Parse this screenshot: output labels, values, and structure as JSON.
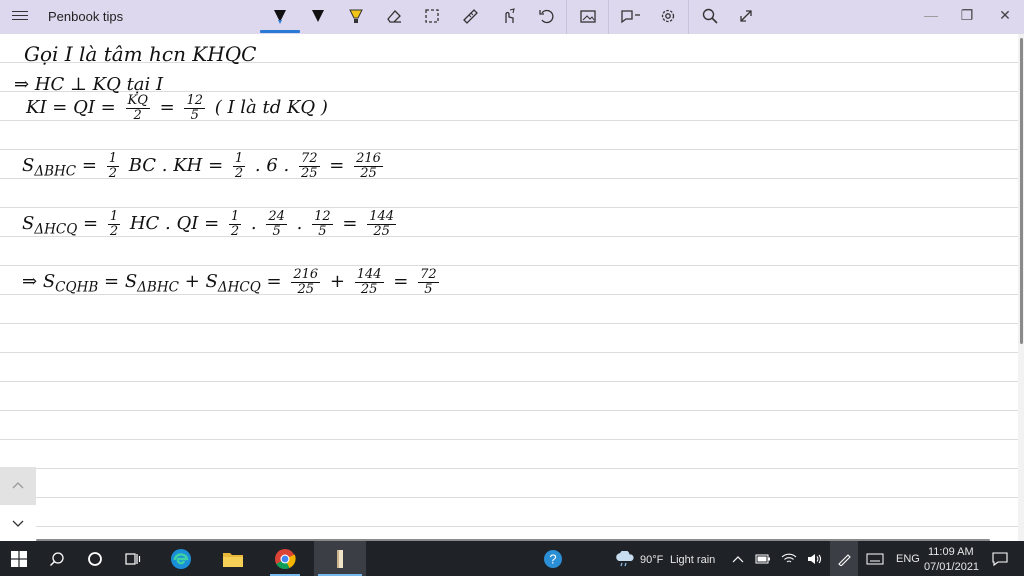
{
  "app": {
    "title": "Penbook tips",
    "window_controls": {
      "minimize": "—",
      "maximize": "❐",
      "close": "✕"
    }
  },
  "toolbar": {
    "tools": [
      "pen-black",
      "pen-black-2",
      "highlighter",
      "eraser",
      "lasso-select",
      "ruler",
      "touch-writing",
      "undo",
      "insert-image",
      "shapes",
      "settings",
      "search",
      "expand"
    ],
    "accent_color": "#2b79d6",
    "highlighter_color": "#f2c318"
  },
  "notes": {
    "line1": "Gọi I là tâm hcn KHQC",
    "line2": "⇒ HC ⊥ KQ tại I",
    "line3": {
      "lhs": "KI = QI =",
      "f1_n": "KQ",
      "f1_d": "2",
      "eq": "=",
      "f2_n": "12",
      "f2_d": "5",
      "note": "( I là td KQ )"
    },
    "line4": {
      "lhs": "S",
      "sub": "ΔBHC",
      "eq1": "=",
      "f1_n": "1",
      "f1_d": "2",
      "mid": "BC . KH =",
      "f2_n": "1",
      "f2_d": "2",
      "mid2": ". 6 .",
      "f3_n": "72",
      "f3_d": "25",
      "eq2": "=",
      "f4_n": "216",
      "f4_d": "25"
    },
    "line5": {
      "lhs": "S",
      "sub": "ΔHCQ",
      "eq1": "=",
      "f1_n": "1",
      "f1_d": "2",
      "mid": "HC . QI =",
      "f2_n": "1",
      "f2_d": "2",
      "dot1": ".",
      "f3_n": "24",
      "f3_d": "5",
      "dot2": ".",
      "f4_n": "12",
      "f4_d": "5",
      "eq2": "=",
      "f5_n": "144",
      "f5_d": "25"
    },
    "line6": {
      "arrow": "⇒",
      "lhs": "S",
      "sub": "CQHB",
      "eq1": "=",
      "t1": "S",
      "t1_sub": "ΔBHC",
      "plus": "+",
      "t2": "S",
      "t2_sub": "ΔHCQ",
      "eq2": "=",
      "f1_n": "216",
      "f1_d": "25",
      "plus2": "+",
      "f2_n": "144",
      "f2_d": "25",
      "eq3": "=",
      "f3_n": "72",
      "f3_d": "5"
    }
  },
  "taskbar": {
    "weather_temp": "90°F",
    "weather_desc": "Light rain",
    "language": "ENG",
    "time": "11:09 AM",
    "date": "07/01/2021"
  }
}
